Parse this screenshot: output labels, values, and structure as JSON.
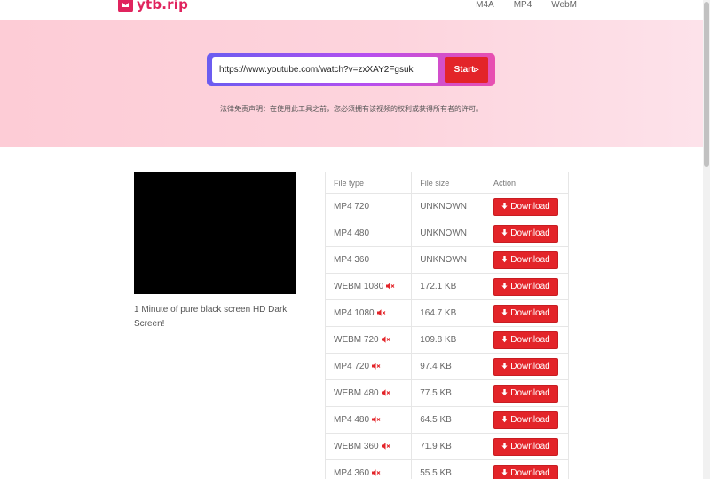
{
  "site": {
    "logo_text": "ytb.rip",
    "brand_color": "#e0245e",
    "nav": [
      {
        "label": "M4A"
      },
      {
        "label": "MP4"
      },
      {
        "label": "WebM"
      }
    ]
  },
  "search": {
    "url_value": "https://www.youtube.com/watch?v=zxXAY2Fgsuk",
    "start_label": "Start▹",
    "disclaimer": "法律免责声明：在使用此工具之前，您必须拥有该视频的权利或获得所有者的许可。"
  },
  "video": {
    "title": "1 Minute of pure black screen HD Dark Screen!"
  },
  "table": {
    "headers": {
      "type": "File type",
      "size": "File size",
      "action": "Action"
    },
    "download_label": "Download",
    "mute_icon": "muted-speaker-icon",
    "accent_color": "#e32429",
    "rows": [
      {
        "type": "MP4 720",
        "size": "UNKNOWN",
        "muted": false
      },
      {
        "type": "MP4 480",
        "size": "UNKNOWN",
        "muted": false
      },
      {
        "type": "MP4 360",
        "size": "UNKNOWN",
        "muted": false
      },
      {
        "type": "WEBM 1080",
        "size": "172.1 KB",
        "muted": true
      },
      {
        "type": "MP4 1080",
        "size": "164.7 KB",
        "muted": true
      },
      {
        "type": "WEBM 720",
        "size": "109.8 KB",
        "muted": true
      },
      {
        "type": "MP4 720",
        "size": "97.4 KB",
        "muted": true
      },
      {
        "type": "WEBM 480",
        "size": "77.5 KB",
        "muted": true
      },
      {
        "type": "MP4 480",
        "size": "64.5 KB",
        "muted": true
      },
      {
        "type": "WEBM 360",
        "size": "71.9 KB",
        "muted": true
      },
      {
        "type": "MP4 360",
        "size": "55.5 KB",
        "muted": true
      }
    ]
  }
}
